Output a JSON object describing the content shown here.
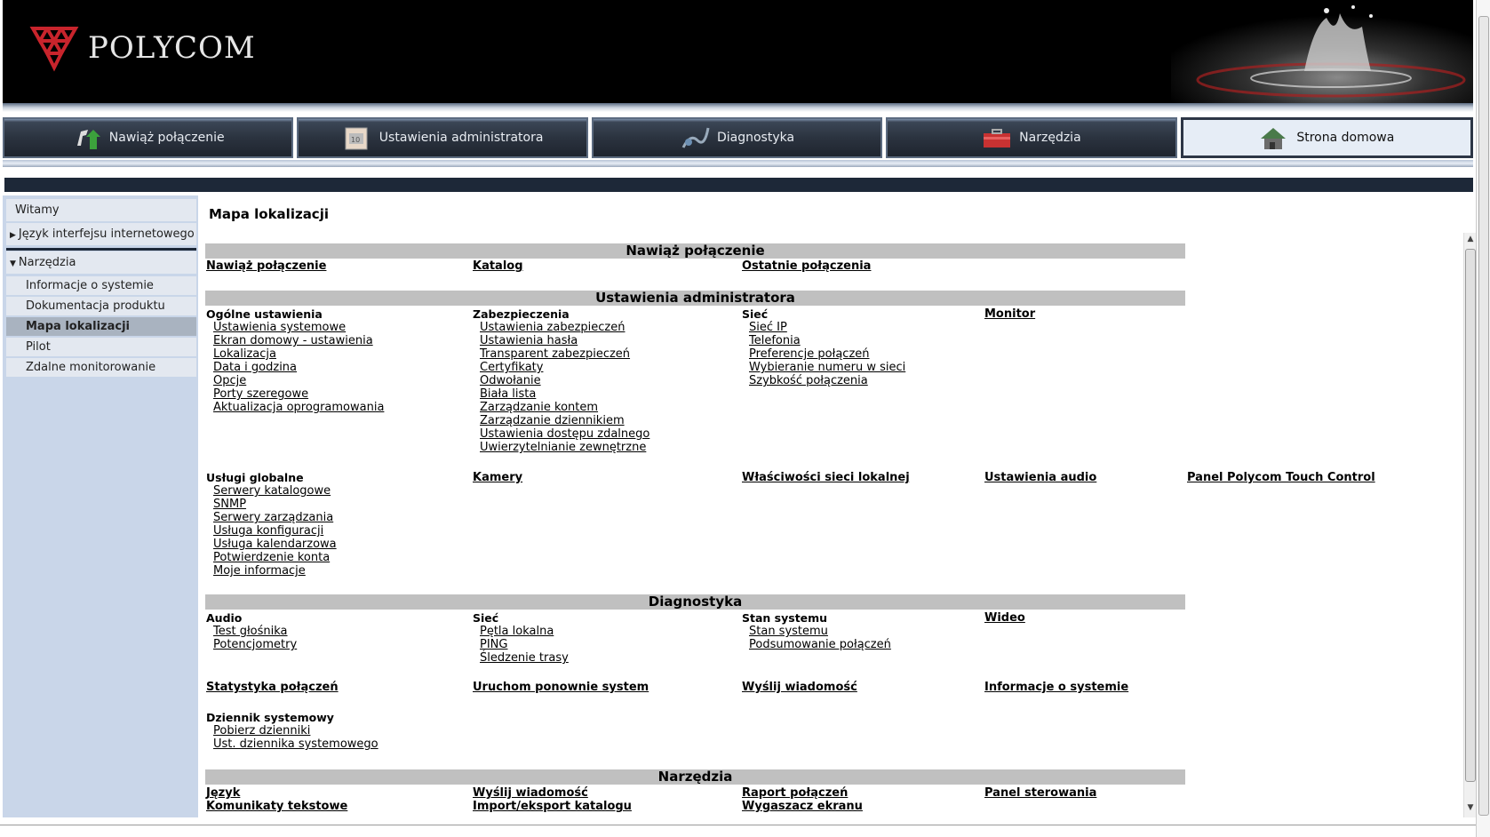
{
  "brand": {
    "name": "POLYCOM"
  },
  "nav": [
    {
      "label": "Nawiąż połączenie",
      "icon": "phone-icon"
    },
    {
      "label": "Ustawienia administratora",
      "icon": "admin-settings-icon"
    },
    {
      "label": "Diagnostyka",
      "icon": "diagnostics-icon"
    },
    {
      "label": "Narzędzia",
      "icon": "toolbox-icon"
    },
    {
      "label": "Strona domowa",
      "icon": "home-icon",
      "active": true
    }
  ],
  "sidebar": {
    "witamy": "Witamy",
    "jezyk": "Język interfejsu internetowego",
    "narzedzia": "Narzędzia",
    "items": [
      "Informacje o systemie",
      "Dokumentacja produktu",
      "Mapa lokalizacji",
      "Pilot",
      "Zdalne monitorowanie"
    ],
    "selected": "Mapa lokalizacji"
  },
  "main": {
    "title": "Mapa lokalizacji",
    "sections": {
      "polaczenie": {
        "header": "Nawiąż połączenie",
        "links": [
          "Nawiąż połączenie",
          "Katalog",
          "Ostatnie połączenia"
        ]
      },
      "admin": {
        "header": "Ustawienia administratora",
        "ogolne": {
          "title": "Ogólne ustawienia",
          "links": [
            "Ustawienia systemowe",
            "Ekran domowy - ustawienia",
            "Lokalizacja",
            "Data i godzina",
            "Opcje",
            "Porty szeregowe",
            "Aktualizacja oprogramowania"
          ]
        },
        "zabezpieczenia": {
          "title": "Zabezpieczenia",
          "links": [
            "Ustawienia zabezpieczeń",
            "Ustawienia hasła",
            "Transparent zabezpieczeń",
            "Certyfikaty",
            "Odwołanie",
            "Biała lista",
            "Zarządzanie kontem",
            "Zarządzanie dziennikiem",
            "Ustawienia dostępu zdalnego",
            "Uwierzytelnianie zewnętrzne"
          ]
        },
        "siec": {
          "title": "Sieć",
          "links": [
            "Sieć IP",
            "Telefonia",
            "Preferencje połączeń",
            "Wybieranie numeru w sieci",
            "Szybkość połączenia"
          ]
        },
        "monitor": "Monitor",
        "uslugi": {
          "title": "Usługi globalne",
          "links": [
            "Serwery katalogowe",
            "SNMP",
            "Serwery zarządzania",
            "Usługa konfiguracji",
            "Usługa kalendarzowa",
            "Potwierdzenie konta",
            "Moje informacje"
          ]
        },
        "kamery": "Kamery",
        "wlasciwosci": "Właściwości sieci lokalnej",
        "audio": "Ustawienia audio",
        "panel": "Panel Polycom Touch Control"
      },
      "diag": {
        "header": "Diagnostyka",
        "audio": {
          "title": "Audio",
          "links": [
            "Test głośnika",
            "Potencjometry"
          ]
        },
        "siec": {
          "title": "Sieć",
          "links": [
            "Pętla lokalna",
            "PING",
            "Śledzenie trasy"
          ]
        },
        "stan": {
          "title": "Stan systemu",
          "links": [
            "Stan systemu",
            "Podsumowanie połączeń"
          ]
        },
        "wideo": "Wideo",
        "row2": [
          "Statystyka połączeń",
          "Uruchom ponownie system",
          "Wyślij wiadomość",
          "Informacje o systemie"
        ],
        "dziennik": {
          "title": "Dziennik systemowy",
          "links": [
            "Pobierz dzienniki",
            "Ust. dziennika systemowego"
          ]
        }
      },
      "narzedzia": {
        "header": "Narzędzia",
        "row1": [
          "Język",
          "Wyślij wiadomość",
          "Raport połączeń",
          "Panel sterowania"
        ],
        "row2": [
          "Komunikaty tekstowe",
          "Import/eksport katalogu",
          "Wygaszacz ekranu"
        ]
      }
    }
  }
}
